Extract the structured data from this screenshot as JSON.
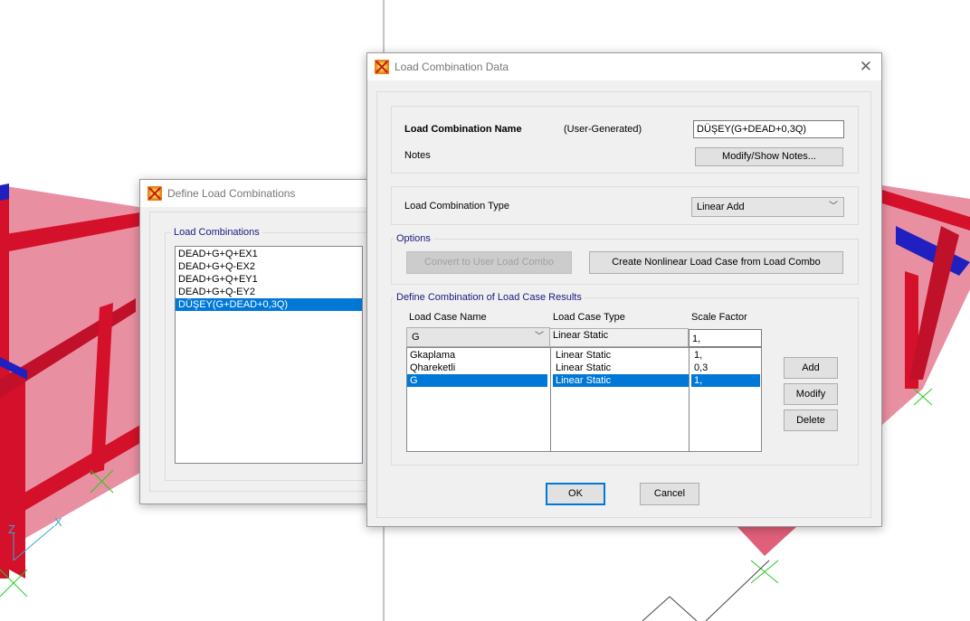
{
  "define_dialog": {
    "title": "Define Load Combinations",
    "group_label": "Load Combinations",
    "combinations": [
      "DEAD+G+Q+EX1",
      "DEAD+G+Q-EX2",
      "DEAD+G+Q+EY1",
      "DEAD+G+Q-EY2",
      "DÜŞEY(G+DEAD+0,3Q)"
    ],
    "selected_index": 4
  },
  "combo_dialog": {
    "title": "Load Combination Data",
    "close_icon": "close-icon",
    "name_label": "Load Combination Name",
    "name_source": "(User-Generated)",
    "name_value": "DÜŞEY(G+DEAD+0,3Q)",
    "notes_label": "Notes",
    "notes_button": "Modify/Show Notes...",
    "type_label": "Load Combination Type",
    "type_value": "Linear Add",
    "options_label": "Options",
    "convert_button": "Convert to User Load Combo",
    "create_nonlinear_button": "Create Nonlinear Load Case from Load Combo",
    "results_label": "Define Combination of Load Case Results",
    "columns": {
      "name": "Load Case Name",
      "type": "Load Case Type",
      "scale": "Scale Factor"
    },
    "edit_row": {
      "name": "G",
      "type": "Linear Static",
      "scale": "1,"
    },
    "rows": [
      {
        "name": "Gkaplama",
        "type": "Linear Static",
        "scale": "1,"
      },
      {
        "name": "Qhareketli",
        "type": "Linear Static",
        "scale": "0,3"
      },
      {
        "name": "G",
        "type": "Linear Static",
        "scale": "1,"
      }
    ],
    "selected_row": 2,
    "add_button": "Add",
    "modify_button": "Modify",
    "delete_button": "Delete",
    "ok_button": "OK",
    "cancel_button": "Cancel"
  },
  "viewport": {
    "axis_z": "Z",
    "axis_x": "X"
  },
  "colors": {
    "accent": "#0078d7",
    "frame_red": "#d4102a",
    "beam_blue": "#2020c0",
    "support_green": "#22cc22"
  }
}
